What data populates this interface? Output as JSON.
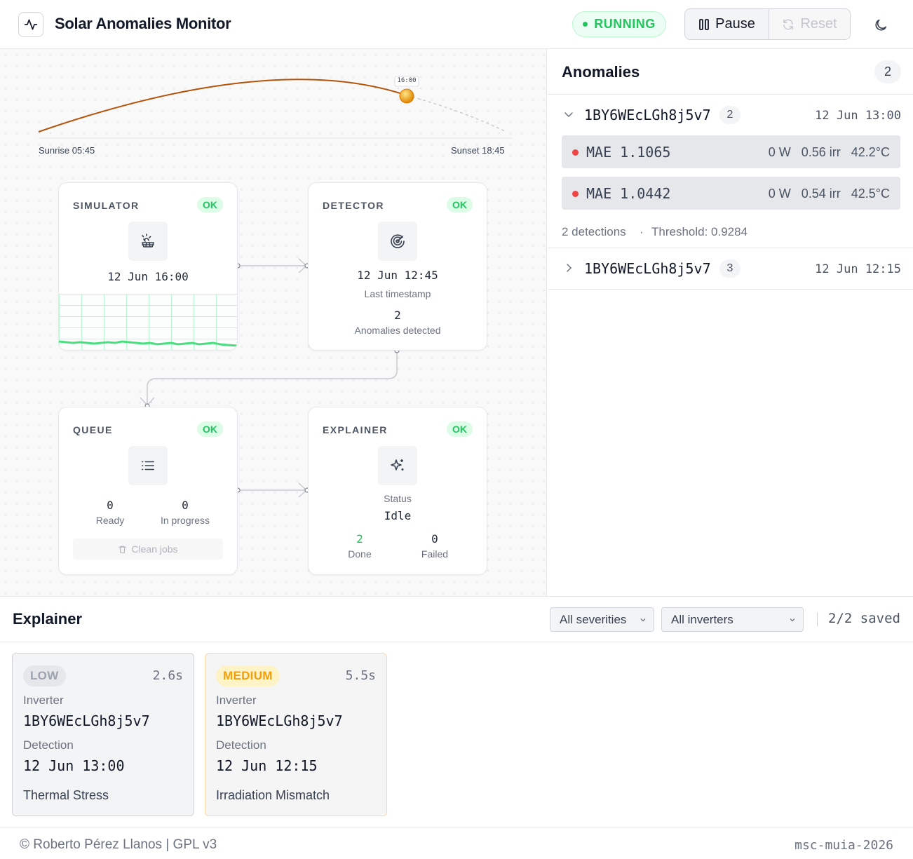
{
  "header": {
    "app_title": "Solar Anomalies Monitor",
    "logo_icon": "activity-icon",
    "status": "RUNNING",
    "pause_label": "Pause",
    "reset_label": "Reset",
    "theme_icon": "moon-icon"
  },
  "sun": {
    "time": "16:00",
    "sunrise": "Sunrise 05:45",
    "sunset": "Sunset 18:45"
  },
  "nodes": {
    "simulator": {
      "title": "SIMULATOR",
      "status": "OK",
      "icon": "solar-panel-icon",
      "timestamp": "12 Jun 16:00"
    },
    "detector": {
      "title": "DETECTOR",
      "status": "OK",
      "icon": "radar-icon",
      "timestamp": "12 Jun 12:45",
      "timestamp_label": "Last timestamp",
      "anomalies": "2",
      "anomalies_label": "Anomalies detected"
    },
    "queue": {
      "title": "QUEUE",
      "status": "OK",
      "icon": "list-icon",
      "ready": "0",
      "ready_label": "Ready",
      "in_progress": "0",
      "in_progress_label": "In progress",
      "clean_label": "Clean jobs"
    },
    "explainer": {
      "title": "EXPLAINER",
      "status": "OK",
      "icon": "sparkles-icon",
      "status_label": "Status",
      "status_value": "Idle",
      "done": "2",
      "done_label": "Done",
      "failed": "0",
      "failed_label": "Failed"
    }
  },
  "anomalies": {
    "title": "Anomalies",
    "count": "2",
    "groups": [
      {
        "inverter": "1BY6WEcLGh8j5v7",
        "count": "2",
        "time": "12 Jun 13:00",
        "expanded": true,
        "detections": [
          {
            "mae": "MAE 1.1065",
            "power": "0 W",
            "irr": "0.56 irr",
            "temp": "42.2°C"
          },
          {
            "mae": "MAE 1.0442",
            "power": "0 W",
            "irr": "0.54 irr",
            "temp": "42.5°C"
          }
        ],
        "footer_detections": "2 detections",
        "footer_sep": "·",
        "footer_threshold": "Threshold: 0.9284"
      },
      {
        "inverter": "1BY6WEcLGh8j5v7",
        "count": "3",
        "time": "12 Jun 12:15",
        "expanded": false
      }
    ]
  },
  "explainer": {
    "title": "Explainer",
    "severity_filter": "All severities",
    "inverter_filter": "All inverters",
    "saved": "2/2 saved",
    "cards": [
      {
        "severity": "LOW",
        "duration": "2.6s",
        "inverter_label": "Inverter",
        "inverter": "1BY6WEcLGh8j5v7",
        "detection_label": "Detection",
        "detection": "12 Jun 13:00",
        "type": "Thermal Stress"
      },
      {
        "severity": "MEDIUM",
        "duration": "5.5s",
        "inverter_label": "Inverter",
        "inverter": "1BY6WEcLGh8j5v7",
        "detection_label": "Detection",
        "detection": "12 Jun 12:15",
        "type": "Irradiation Mismatch"
      }
    ]
  },
  "footer": {
    "left": "© Roberto Pérez Llanos | GPL v3",
    "right": "msc-muia-2026"
  },
  "colors": {
    "accent_green": "#22c55e",
    "sun_arc": "#b45309",
    "sun": "#f59e0b",
    "anomaly_red": "#ef4444",
    "medium_amber": "#f59e0b"
  }
}
